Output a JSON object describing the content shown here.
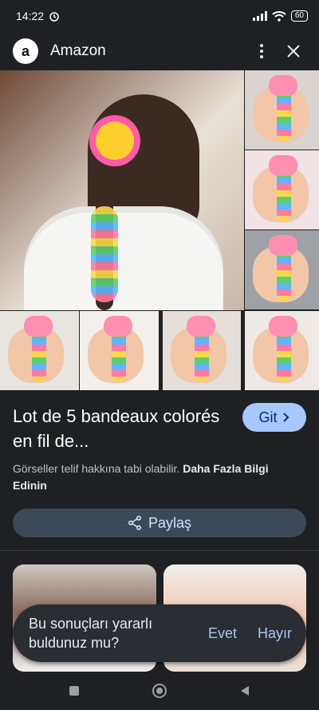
{
  "status": {
    "time": "14:22",
    "alarm_icon": "alarm-clock-icon",
    "signal_icon": "signal-icon",
    "wifi_icon": "wifi-icon",
    "battery": "60"
  },
  "header": {
    "site_logo": "a",
    "site_title": "Amazon",
    "more_icon": "vertical-dots-icon",
    "close_icon": "close-icon"
  },
  "product": {
    "title": "Lot de 5 bandeaux colorés en fil de...",
    "visit_label": "Git",
    "copyright_text": "Görseller telif hakkına tabi olabilir.",
    "learn_more": "Daha Fazla Bilgi Edinin",
    "share_label": "Paylaş"
  },
  "feedback": {
    "question": "Bu sonuçları yararlı buldunuz mu?",
    "yes": "Evet",
    "no": "Hayır"
  },
  "nav": {
    "recents_icon": "square-icon",
    "home_icon": "circle-icon",
    "back_icon": "back-triangle-icon"
  },
  "colors": {
    "accent": "#a8c7fa",
    "background": "#1f2023",
    "share_bg": "#3c4858"
  }
}
